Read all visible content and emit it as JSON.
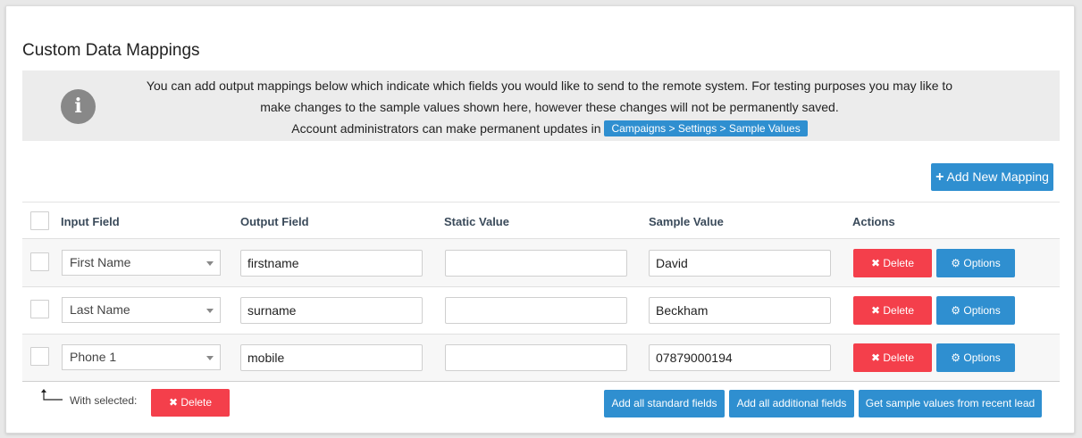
{
  "page": {
    "title": "Custom Data Mappings"
  },
  "info": {
    "icon": "info-icon",
    "line1": "You can add output mappings below which indicate which fields you would like to send to the remote system. For testing purposes you may like to",
    "line2": "make changes to the sample values shown here, however these changes will not be permanently saved.",
    "line3": "Account administrators can make permanent updates in",
    "link_label": "Campaigns > Settings > Sample Values"
  },
  "toolbar": {
    "add_mapping_label": "Add New Mapping",
    "add_mapping_icon": "plus-icon"
  },
  "table": {
    "headers": {
      "input": "Input Field",
      "output": "Output Field",
      "static": "Static Value",
      "sample": "Sample Value",
      "actions": "Actions"
    },
    "rows": [
      {
        "input": "First Name",
        "output": "firstname",
        "static": "",
        "sample": "David",
        "delete_label": "Delete",
        "options_label": "Options"
      },
      {
        "input": "Last Name",
        "output": "surname",
        "static": "",
        "sample": "Beckham",
        "delete_label": "Delete",
        "options_label": "Options"
      },
      {
        "input": "Phone 1",
        "output": "mobile",
        "static": "",
        "sample": "07879000194",
        "delete_label": "Delete",
        "options_label": "Options"
      }
    ]
  },
  "footer": {
    "with_selected": "With selected:",
    "delete_label": "Delete",
    "add_standard": "Add all standard fields",
    "add_additional": "Add all additional fields",
    "get_samples": "Get sample values from recent lead"
  },
  "colors": {
    "accent": "#2f8fd0",
    "danger": "#f43f4b",
    "info_bg": "#ececec"
  }
}
